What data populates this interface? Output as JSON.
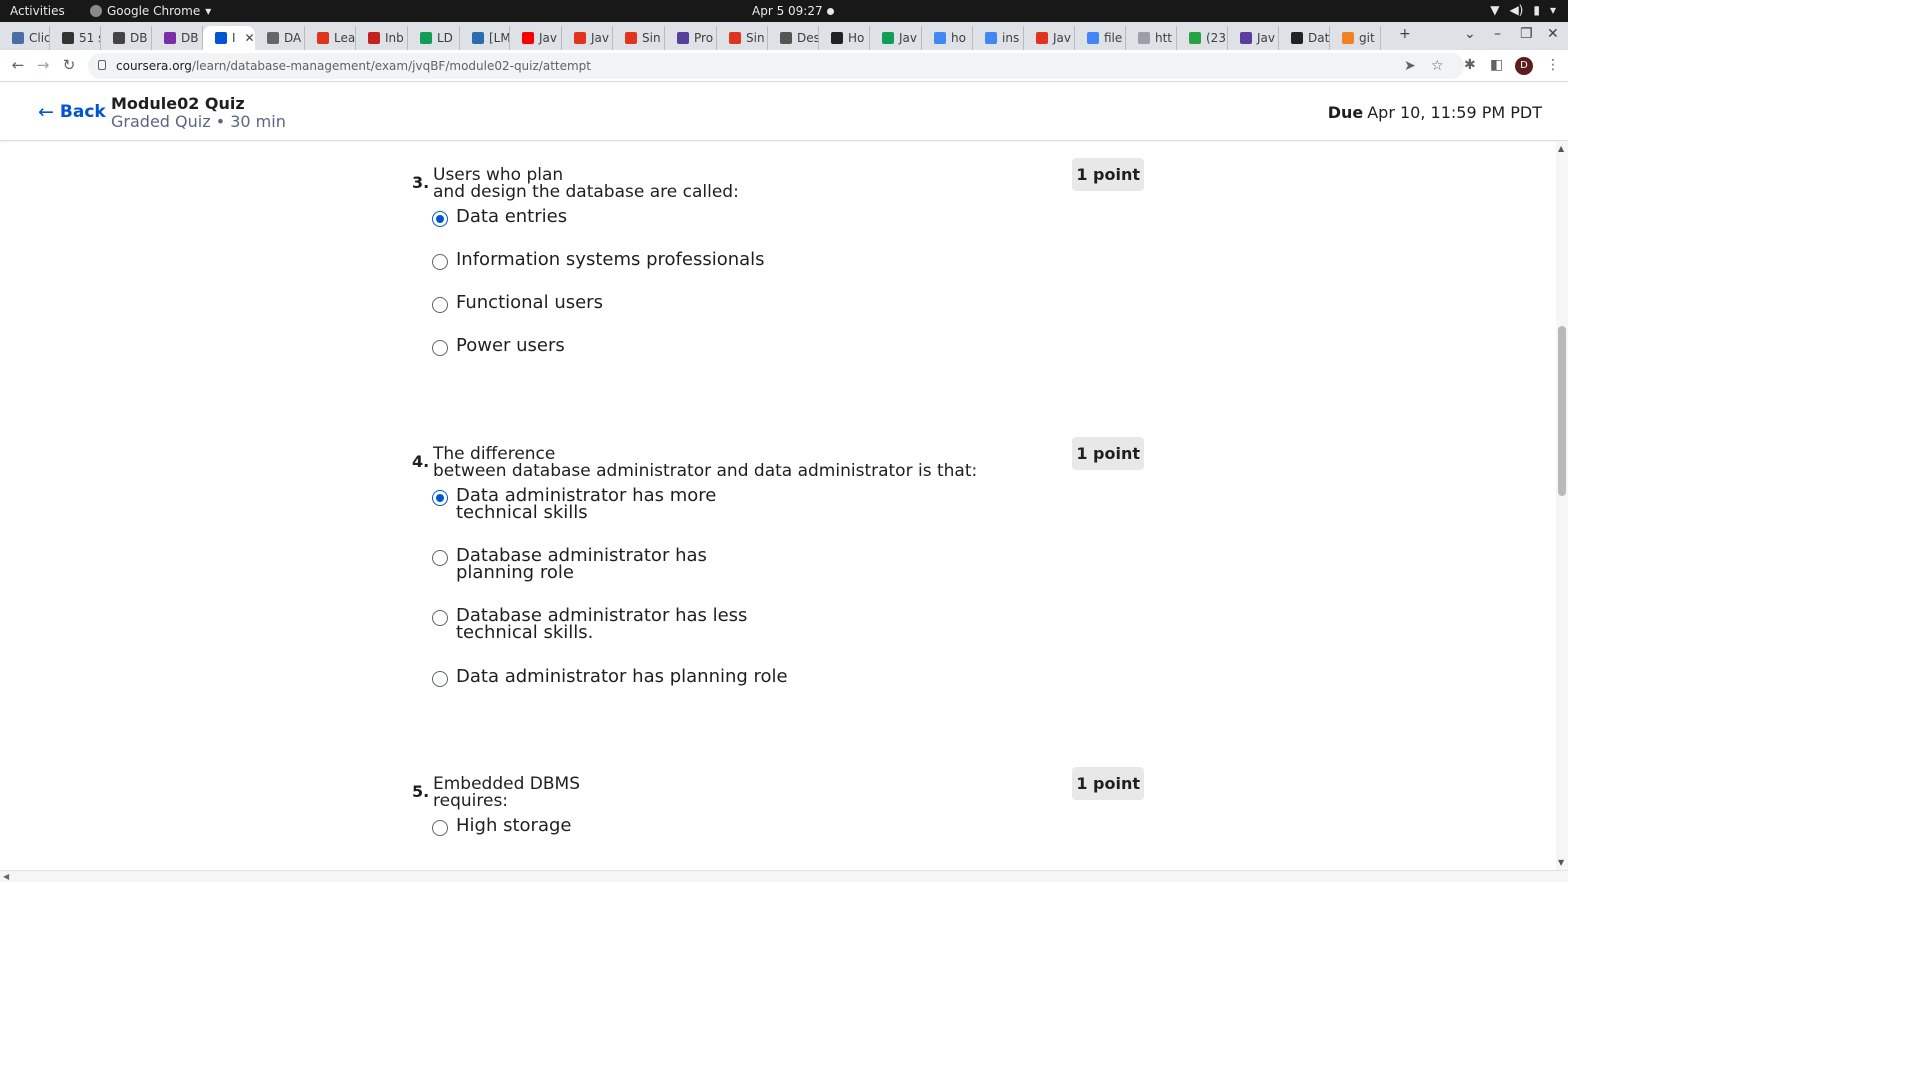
{
  "os_bar": {
    "activities": "Activities",
    "app_name": "Google Chrome",
    "clock": "Apr 5  09:27"
  },
  "tabs": [
    {
      "label": "Clic",
      "color": "#4a6fa5"
    },
    {
      "label": "51 s",
      "color": "#333333"
    },
    {
      "label": "DB",
      "color": "#444444"
    },
    {
      "label": "DB",
      "color": "#7b2ea8"
    },
    {
      "label": "I",
      "color": "#0056d2",
      "active": true
    },
    {
      "label": "DA",
      "color": "#666666"
    },
    {
      "label": "Lea",
      "color": "#e0341f"
    },
    {
      "label": "Inb",
      "color": "#c5221f"
    },
    {
      "label": "LD",
      "color": "#0f9d58"
    },
    {
      "label": "[LM",
      "color": "#2b6cb0"
    },
    {
      "label": "Jav",
      "color": "#ff0000"
    },
    {
      "label": "Jav",
      "color": "#e0341f"
    },
    {
      "label": "Sin",
      "color": "#e0341f"
    },
    {
      "label": "Pro",
      "color": "#5a3e9b"
    },
    {
      "label": "Sin",
      "color": "#e0341f"
    },
    {
      "label": "Des",
      "color": "#555555"
    },
    {
      "label": "Ho",
      "color": "#222222"
    },
    {
      "label": "Jav",
      "color": "#0f9d58"
    },
    {
      "label": "ho",
      "color": "#4285f4"
    },
    {
      "label": "ins",
      "color": "#4285f4"
    },
    {
      "label": "Jav",
      "color": "#e0341f"
    },
    {
      "label": "file",
      "color": "#4285f4"
    },
    {
      "label": "htt",
      "color": "#9aa0a6"
    },
    {
      "label": "(23",
      "color": "#25a244"
    },
    {
      "label": "Jav",
      "color": "#5a3e9b"
    },
    {
      "label": "Dat",
      "color": "#222222"
    },
    {
      "label": "git",
      "color": "#f48024"
    }
  ],
  "address": {
    "host": "coursera.org",
    "path": "/learn/database-management/exam/jvqBF/module02-quiz/attempt",
    "profile_initial": "D"
  },
  "header": {
    "back_label": "Back",
    "title": "Module02 Quiz",
    "subtitle": "Graded Quiz • 30 min",
    "due_label": "Due",
    "due_value": "Apr 10, 11:59 PM PDT"
  },
  "questions": [
    {
      "number": "3.",
      "text": "Users who plan\nand design the database are called:",
      "points": "1 point",
      "options": [
        {
          "label": "Data entries",
          "checked": true
        },
        {
          "label": "Information systems professionals",
          "checked": false
        },
        {
          "label": "Functional users",
          "checked": false
        },
        {
          "label": "Power users",
          "checked": false
        }
      ]
    },
    {
      "number": "4.",
      "text": "The difference\nbetween database administrator and data administrator is that:",
      "points": "1 point",
      "options": [
        {
          "label": "Data administrator has more\ntechnical skills",
          "checked": true
        },
        {
          "label": "Database administrator has\nplanning role",
          "checked": false
        },
        {
          "label": "Database administrator has less\ntechnical skills.",
          "checked": false
        },
        {
          "label": "Data administrator has planning role",
          "checked": false
        }
      ]
    },
    {
      "number": "5.",
      "text": "Embedded DBMS\nrequires:",
      "points": "1 point",
      "options": [
        {
          "label": "High storage",
          "checked": false
        }
      ]
    }
  ]
}
